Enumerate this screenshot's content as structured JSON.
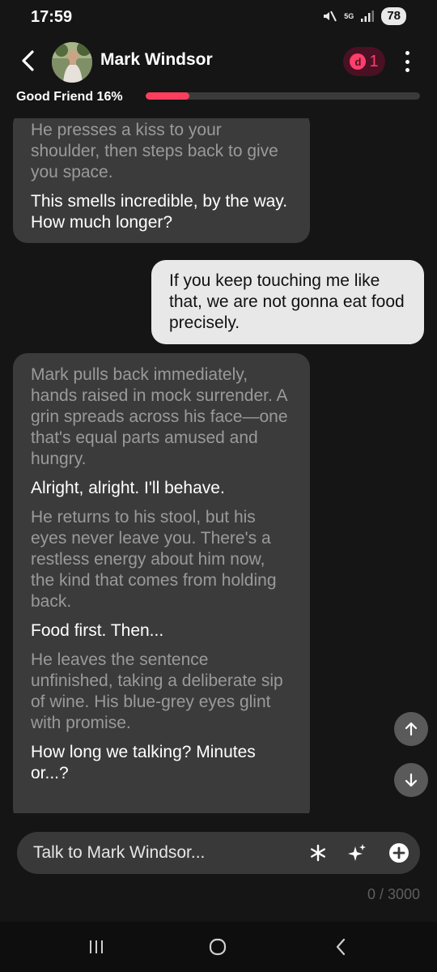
{
  "status_bar": {
    "time": "17:59",
    "network": "5G",
    "battery": "78",
    "icons": [
      "mute-icon",
      "network-5g-icon",
      "signal-icon",
      "battery-icon"
    ]
  },
  "header": {
    "contact_name": "Mark Windsor",
    "coin_count": "1",
    "coin_symbol": "d"
  },
  "relationship": {
    "label": "Good Friend 16%",
    "progress": 0.16,
    "color": "#ff3e5e"
  },
  "messages": [
    {
      "role": "character",
      "parts": [
        {
          "type": "narration",
          "text": "He presses a kiss to your shoulder, then steps back to give you space."
        },
        {
          "type": "speech",
          "text": "This smells incredible, by the way. How much longer?"
        }
      ]
    },
    {
      "role": "user",
      "text": "If you keep touching me like that, we are not gonna eat food precisely."
    },
    {
      "role": "character",
      "parts": [
        {
          "type": "narration",
          "text": "Mark pulls back immediately, hands raised in mock surrender. A grin spreads across his face—one that's equal parts amused and hungry."
        },
        {
          "type": "speech",
          "text": "Alright, alright. I'll behave."
        },
        {
          "type": "narration",
          "text": "He returns to his stool, but his eyes never leave you. There's a restless energy about him now, the kind that comes from holding back."
        },
        {
          "type": "speech",
          "text": "Food first. Then..."
        },
        {
          "type": "narration",
          "text": "He leaves the sentence unfinished, taking a deliberate sip of wine. His blue-grey eyes glint with promise."
        },
        {
          "type": "speech",
          "text": "How long we talking? Minutes or...?"
        }
      ]
    }
  ],
  "input": {
    "placeholder": "Talk to Mark Windsor...",
    "value": "",
    "char_count": "0 / 3000"
  },
  "colors": {
    "background": "#151515",
    "ai_bubble": "#3b3b3b",
    "user_bubble": "#e8e8e8",
    "accent": "#ff3e6b"
  }
}
